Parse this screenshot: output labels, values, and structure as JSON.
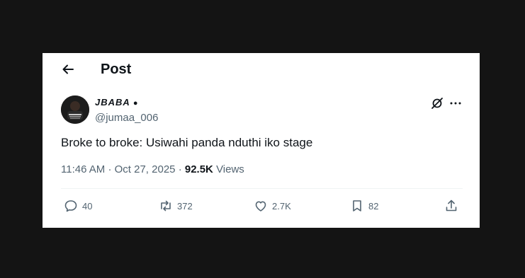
{
  "header": {
    "title": "Post"
  },
  "author": {
    "display_name": "JBABA",
    "handle": "@jumaa_006"
  },
  "tweet": {
    "text": "Broke to broke: Usiwahi panda nduthi iko stage"
  },
  "meta": {
    "time": "11:46 AM",
    "separator": "·",
    "date": "Oct 27, 2025",
    "views_count": "92.5K",
    "views_label": "Views"
  },
  "actions": {
    "replies": "40",
    "reposts": "372",
    "likes": "2.7K",
    "bookmarks": "82"
  },
  "colors": {
    "text": "#0f1419",
    "muted": "#536471",
    "background": "#141414",
    "card": "#ffffff"
  },
  "icons": [
    "back-arrow-icon",
    "grok-icon",
    "more-icon",
    "reply-icon",
    "repost-icon",
    "like-icon",
    "bookmark-icon",
    "share-icon"
  ]
}
